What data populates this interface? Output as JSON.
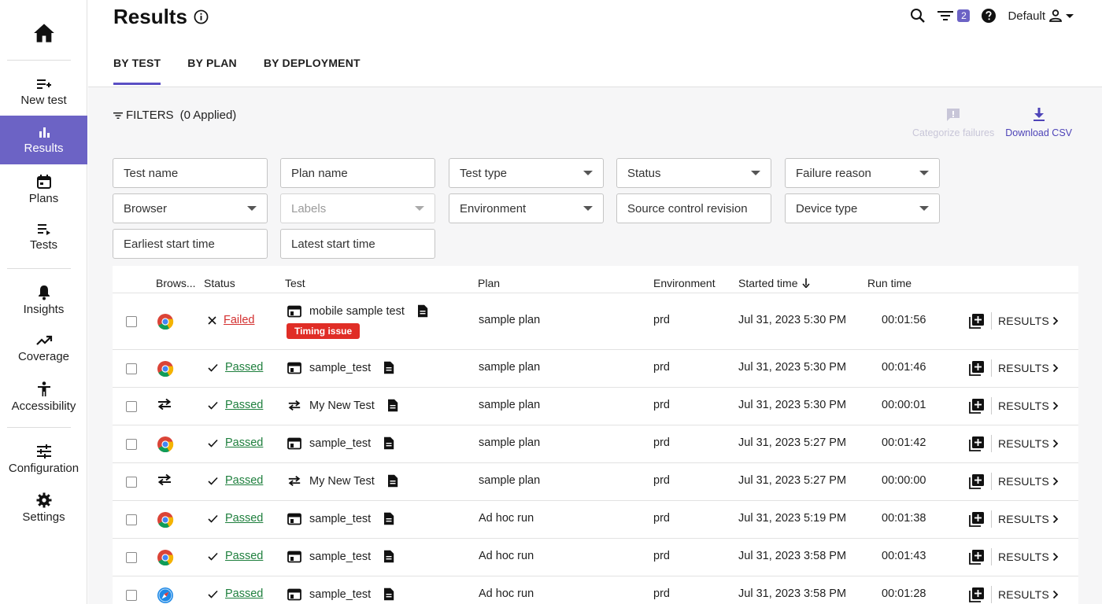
{
  "sidebar": {
    "items": [
      {
        "label": "New test"
      },
      {
        "label": "Results"
      },
      {
        "label": "Plans"
      },
      {
        "label": "Tests"
      },
      {
        "label": "Insights"
      },
      {
        "label": "Coverage"
      },
      {
        "label": "Accessibility"
      },
      {
        "label": "Configuration"
      },
      {
        "label": "Settings"
      }
    ]
  },
  "header": {
    "title": "Results",
    "filter_count": "2",
    "user_label": "Default"
  },
  "tabs": [
    {
      "label": "BY TEST"
    },
    {
      "label": "BY PLAN"
    },
    {
      "label": "BY DEPLOYMENT"
    }
  ],
  "filters": {
    "label": "FILTERS",
    "applied": "(0 Applied)",
    "categorize_label": "Categorize failures",
    "download_label": "Download CSV",
    "fields": {
      "test_name": "Test name",
      "plan_name": "Plan name",
      "test_type": "Test type",
      "status": "Status",
      "failure_reason": "Failure reason",
      "browser": "Browser",
      "labels": "Labels",
      "environment": "Environment",
      "source_control": "Source control revision",
      "device_type": "Device type",
      "earliest_start": "Earliest start time",
      "latest_start": "Latest start time"
    }
  },
  "table": {
    "headers": {
      "browser": "Brows...",
      "status": "Status",
      "test": "Test",
      "plan": "Plan",
      "environment": "Environment",
      "started": "Started time",
      "runtime": "Run time"
    },
    "results_label": "RESULTS",
    "rows": [
      {
        "browser": "chrome",
        "status": "Failed",
        "test": "mobile sample test",
        "tag": "Timing issue",
        "test_icon": "window-icon",
        "plan": "sample plan",
        "env": "prd",
        "started": "Jul 31, 2023 5:30 PM",
        "runtime": "00:01:56"
      },
      {
        "browser": "chrome",
        "status": "Passed",
        "test": "sample_test",
        "test_icon": "window-icon",
        "plan": "sample plan",
        "env": "prd",
        "started": "Jul 31, 2023 5:30 PM",
        "runtime": "00:01:46"
      },
      {
        "browser": "api",
        "status": "Passed",
        "test": "My New Test",
        "test_icon": "swap-icon",
        "plan": "sample plan",
        "env": "prd",
        "started": "Jul 31, 2023 5:30 PM",
        "runtime": "00:00:01"
      },
      {
        "browser": "chrome",
        "status": "Passed",
        "test": "sample_test",
        "test_icon": "window-icon",
        "plan": "sample plan",
        "env": "prd",
        "started": "Jul 31, 2023 5:27 PM",
        "runtime": "00:01:42"
      },
      {
        "browser": "api",
        "status": "Passed",
        "test": "My New Test",
        "test_icon": "swap-icon",
        "plan": "sample plan",
        "env": "prd",
        "started": "Jul 31, 2023 5:27 PM",
        "runtime": "00:00:00"
      },
      {
        "browser": "chrome",
        "status": "Passed",
        "test": "sample_test",
        "test_icon": "window-icon",
        "plan": "Ad hoc run",
        "env": "prd",
        "started": "Jul 31, 2023 5:19 PM",
        "runtime": "00:01:38"
      },
      {
        "browser": "chrome",
        "status": "Passed",
        "test": "sample_test",
        "test_icon": "window-icon",
        "plan": "Ad hoc run",
        "env": "prd",
        "started": "Jul 31, 2023 3:58 PM",
        "runtime": "00:01:43"
      },
      {
        "browser": "safari",
        "status": "Passed",
        "test": "sample_test",
        "test_icon": "window-icon",
        "plan": "Ad hoc run",
        "env": "prd",
        "started": "Jul 31, 2023 3:58 PM",
        "runtime": "00:01:28"
      }
    ]
  },
  "colors": {
    "accent": "#6c63c5",
    "passed": "#1e7f3d",
    "failed": "#d32f2f",
    "tag": "#e02d26"
  }
}
